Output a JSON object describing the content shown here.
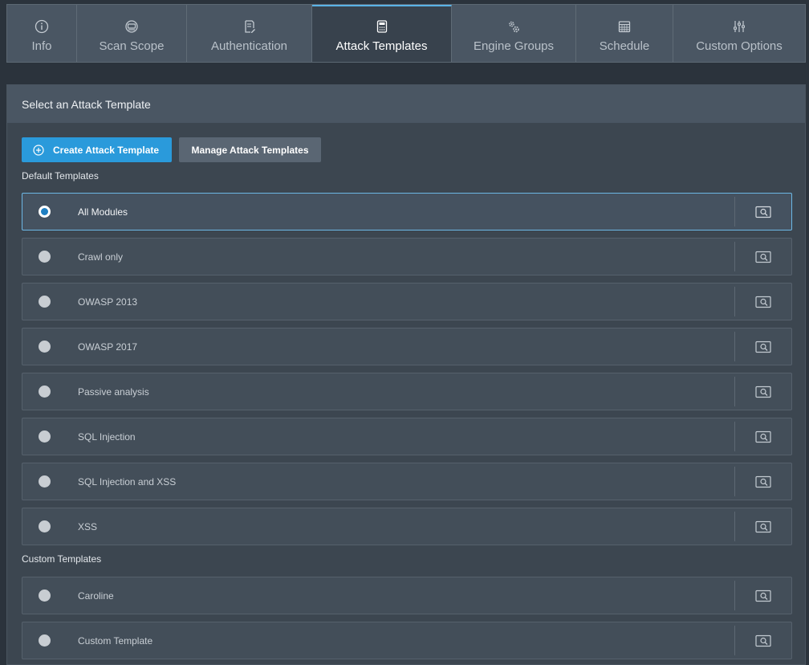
{
  "tabs": [
    {
      "label": "Info",
      "icon": "info-icon"
    },
    {
      "label": "Scan Scope",
      "icon": "scope-icon"
    },
    {
      "label": "Authentication",
      "icon": "document-edit-icon"
    },
    {
      "label": "Attack Templates",
      "icon": "calculator-icon",
      "active": true
    },
    {
      "label": "Engine Groups",
      "icon": "gears-icon"
    },
    {
      "label": "Schedule",
      "icon": "calendar-icon"
    },
    {
      "label": "Custom Options",
      "icon": "sliders-icon"
    }
  ],
  "panel": {
    "title": "Select an Attack Template",
    "create_label": "Create Attack Template",
    "manage_label": "Manage Attack Templates",
    "default_label": "Default Templates",
    "custom_label": "Custom Templates"
  },
  "default_templates": [
    {
      "label": "All Modules",
      "selected": true
    },
    {
      "label": "Crawl only"
    },
    {
      "label": "OWASP 2013"
    },
    {
      "label": "OWASP 2017"
    },
    {
      "label": "Passive analysis"
    },
    {
      "label": "SQL Injection"
    },
    {
      "label": "SQL Injection and XSS"
    },
    {
      "label": "XSS"
    }
  ],
  "custom_templates": [
    {
      "label": "Caroline"
    },
    {
      "label": "Custom Template"
    }
  ],
  "colors": {
    "accent": "#2a9adb",
    "background": "#2b333c",
    "panel": "#3c4650"
  }
}
